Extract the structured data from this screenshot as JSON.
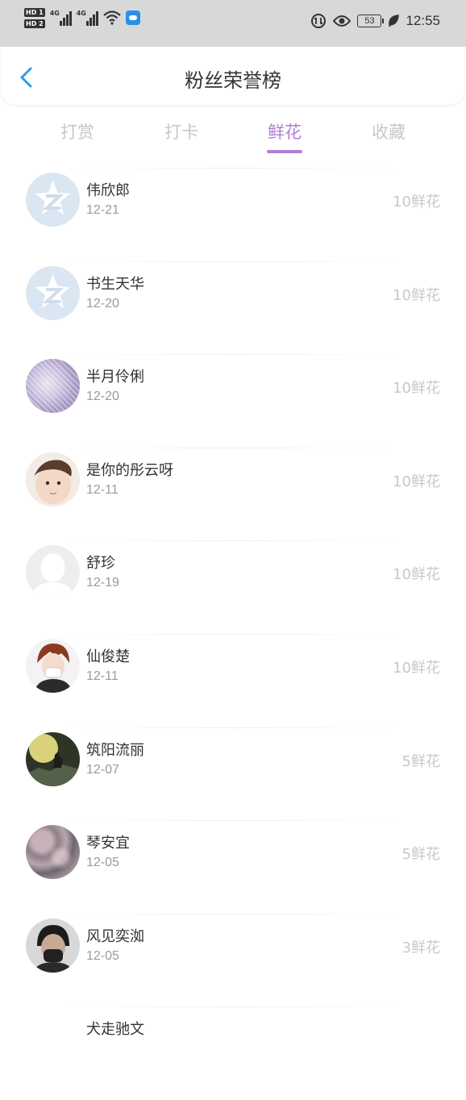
{
  "status_bar": {
    "sim1": "HD 1",
    "sim2": "HD 2",
    "net1": "4G",
    "net2": "4G",
    "battery": "53",
    "time": "12:55"
  },
  "header": {
    "title": "粉丝荣誉榜"
  },
  "tabs": [
    {
      "label": "打赏",
      "active": false
    },
    {
      "label": "打卡",
      "active": false
    },
    {
      "label": "鲜花",
      "active": true
    },
    {
      "label": "收藏",
      "active": false
    }
  ],
  "colors": {
    "accent": "#b07fd4",
    "back_arrow": "#2b9de8"
  },
  "fans": [
    {
      "name": "伟欣郎",
      "date": "12-21",
      "amount": "10鲜花",
      "avatar": "qq-default-icon"
    },
    {
      "name": "书生天华",
      "date": "12-20",
      "amount": "10鲜花",
      "avatar": "qq-default-icon"
    },
    {
      "name": "半月伶俐",
      "date": "12-20",
      "amount": "10鲜花",
      "avatar": "pattern-photo"
    },
    {
      "name": "是你的彤云呀",
      "date": "12-11",
      "amount": "10鲜花",
      "avatar": "baby-photo"
    },
    {
      "name": "舒珍",
      "date": "12-19",
      "amount": "10鲜花",
      "avatar": "default-silhouette-icon"
    },
    {
      "name": "仙俊楚",
      "date": "12-11",
      "amount": "10鲜花",
      "avatar": "anime-character"
    },
    {
      "name": "筑阳流丽",
      "date": "12-07",
      "amount": "5鲜花",
      "avatar": "wolf-moon-photo"
    },
    {
      "name": "琴安宜",
      "date": "12-05",
      "amount": "5鲜花",
      "avatar": "floral-photo"
    },
    {
      "name": "风见奕洳",
      "date": "12-05",
      "amount": "3鲜花",
      "avatar": "masked-person-photo"
    },
    {
      "name": "犬走驰文",
      "date": "",
      "amount": "",
      "avatar": "none"
    }
  ]
}
